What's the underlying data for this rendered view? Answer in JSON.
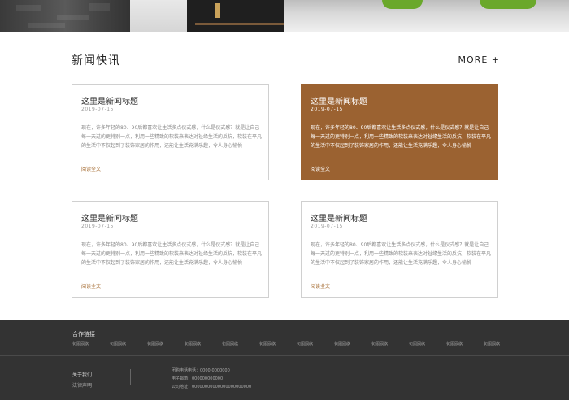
{
  "section": {
    "title": "新闻快讯",
    "more_label": "MORE +"
  },
  "cards": [
    {
      "title": "这里是新闻标题",
      "date": "2019-07-15",
      "excerpt": "现在，许多年轻的80、90后都喜欢让生活多点仪式感，什么是仪式感？就是让自己每一天过的更特别一点，利用一些精致的软装来表达对祉缘生活的反抗，软装在平凡的生活中不仅起到了装饰家居的作用，还能让生活充满乐趣，令人身心愉悦",
      "read_more": "阅读全文"
    },
    {
      "title": "这里是新闻标题",
      "date": "2019-07-15",
      "excerpt": "现在，许多年轻的80、90后都喜欢让生活多点仪式感，什么是仪式感？就是让自己每一天过的更特别一点，利用一些精致的软装来表达对祉缘生活的反抗，软装在平凡的生活中不仅起到了装饰家居的作用，还能让生活充满乐趣，令人身心愉悦",
      "read_more": "阅读全文"
    },
    {
      "title": "这里是新闻标题",
      "date": "2019-07-15",
      "excerpt": "现在，许多年轻的80、90后都喜欢让生活多点仪式感，什么是仪式感？就是让自己每一天过的更特别一点，利用一些精致的软装来表达对祉缘生活的反抗，软装在平凡的生活中不仅起到了装饰家居的作用，还能让生活充满乐趣，令人身心愉悦",
      "read_more": "阅读全文"
    },
    {
      "title": "这里是新闻标题",
      "date": "2019-07-15",
      "excerpt": "现在，许多年轻的80、90后都喜欢让生活多点仪式感，什么是仪式感？就是让自己每一天过的更特别一点，利用一些精致的软装来表达对祉缘生活的反抗，软装在平凡的生活中不仅起到了装饰家居的作用，还能让生活充满乐趣，令人身心愉悦",
      "read_more": "阅读全文"
    }
  ],
  "footer": {
    "links_title": "合作链接",
    "links": [
      "包图网络",
      "包图网络",
      "包图网络",
      "包图网络",
      "包图网络",
      "包图网络",
      "包图网络",
      "包图网络",
      "包图网络",
      "包图网络",
      "包图网络",
      "包图网络"
    ],
    "about": "关于我们",
    "legal": "法律声明",
    "contact": [
      "团购电话电话：0000-0000000",
      "电子邮箱：000000000000",
      "公司地址：00000000000000000000000"
    ]
  },
  "colors": {
    "accent": "#9b6231",
    "footer_bg": "#333333"
  }
}
